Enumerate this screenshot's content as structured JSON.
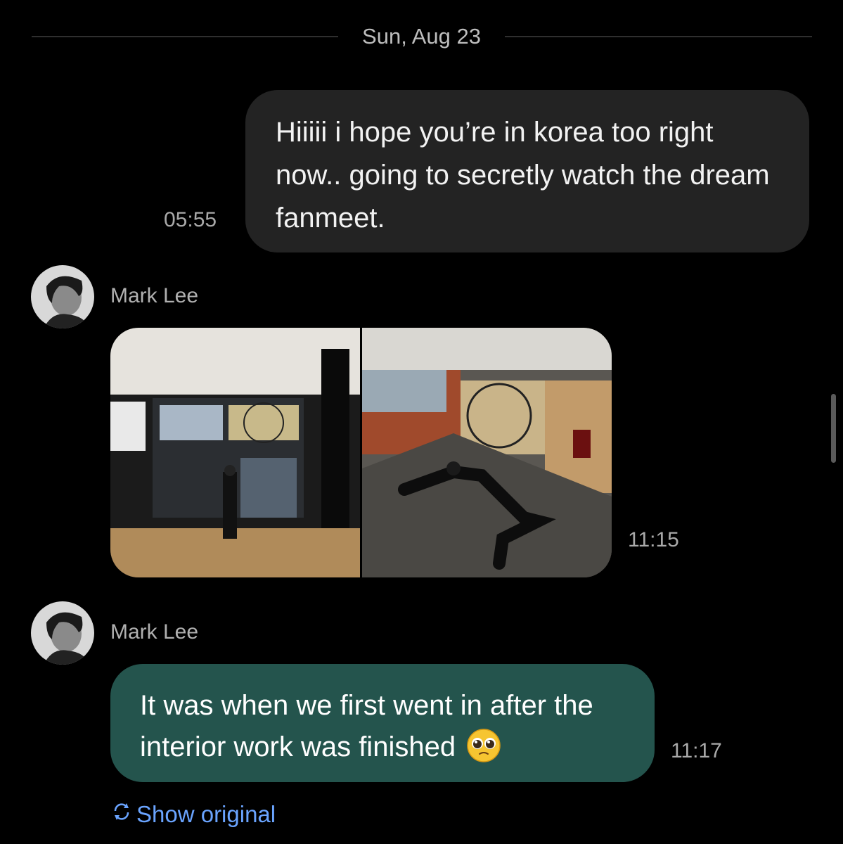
{
  "date_divider": "Sun, Aug 23",
  "messages": [
    {
      "direction": "outgoing",
      "text": "Hiiiii i hope you’re in korea too right now.. going to secretly watch the dream fanmeet.",
      "time": "05:55"
    },
    {
      "direction": "incoming",
      "sender": "Mark Lee",
      "type": "photos",
      "photos": [
        "dance-studio-standing",
        "dance-studio-lying-on-floor"
      ],
      "time": "11:15"
    },
    {
      "direction": "incoming",
      "sender": "Mark Lee",
      "text": "It was when we first went in after the interior work was finished",
      "emoji": "pleading-face",
      "time": "11:17",
      "translate_action": "Show original"
    }
  ],
  "colors": {
    "background": "#000000",
    "outgoing_bubble": "#232323",
    "incoming_bubble": "#24544d",
    "link": "#6aa4ff"
  }
}
